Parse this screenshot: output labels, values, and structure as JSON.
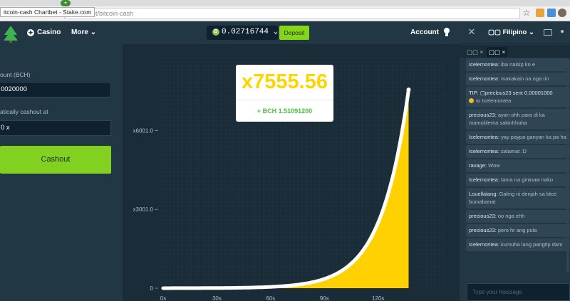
{
  "browser": {
    "tab_tooltip": "itcoin-cash Chartbet - Stake.com",
    "url": "s/chartbet/bitcoin-cash",
    "new_tab": "+",
    "star": "☆"
  },
  "header": {
    "casino_label": "Casino",
    "casino_icon": "✦",
    "more_label": "More",
    "chevron": "⌄",
    "balance": "0.02716744",
    "coin_symbol": "B",
    "deposit_label": "Deposit",
    "account_label": "Account"
  },
  "bet_panel": {
    "amount_label": "ount (BCH)",
    "amount_value": "0020000",
    "autocashout_label": "atically cashout at",
    "autocashout_value": "0 x",
    "cashout_label": "Cashout"
  },
  "chart_data": {
    "type": "line",
    "x_tick_labels": [
      "0s",
      "30s",
      "60s",
      "90s",
      "120s"
    ],
    "y_tick_labels": [
      "0",
      "x3001.0",
      "x6001.0"
    ],
    "xlim": [
      0,
      138
    ],
    "ylim": [
      0,
      7555.56
    ],
    "curve_end": {
      "x": 137,
      "y": 7555.56
    },
    "multiplier_label": "x7555.56",
    "profit_label": "+ BCH 1.51091200",
    "line_color": "#ffffff",
    "fill_color": "#ffd100"
  },
  "chat": {
    "close_icon": "✕",
    "language_label": "▢▢ Filipino",
    "user_icon": "●",
    "tabs": [
      "▢▢ ×",
      "▢▢ ×"
    ],
    "messages": [
      {
        "user": "Icelemontea:",
        "text": "iba naisip ko e"
      },
      {
        "user": "Icelemontea:",
        "text": "makakain na nga rin"
      },
      {
        "user": "TIP: ▢preclous23 sent 0.00001000",
        "text": "to Icelemontea",
        "coin": true
      },
      {
        "user": "precious23:",
        "text": "ayan ohh para di ka mamoblema sakinhhaha"
      },
      {
        "user": "Icelemontea:",
        "text": "yay paypa ganyan ka pa ha"
      },
      {
        "user": "Icelemontea:",
        "text": "salamat :D"
      },
      {
        "user": "ravage:",
        "text": "Wow"
      },
      {
        "user": "Icelemontea:",
        "text": "tama na gininaw nako"
      },
      {
        "user": "Louellalang:",
        "text": "Galing ni denjah sa btce bumabanat"
      },
      {
        "user": "precious23:",
        "text": "oo nga ehh"
      },
      {
        "user": "precious23:",
        "text": "pero hr ang pula"
      },
      {
        "user": "Icelemontea:",
        "text": "kumuha lang pangtip dam"
      }
    ],
    "input_placeholder": "Type your message"
  }
}
